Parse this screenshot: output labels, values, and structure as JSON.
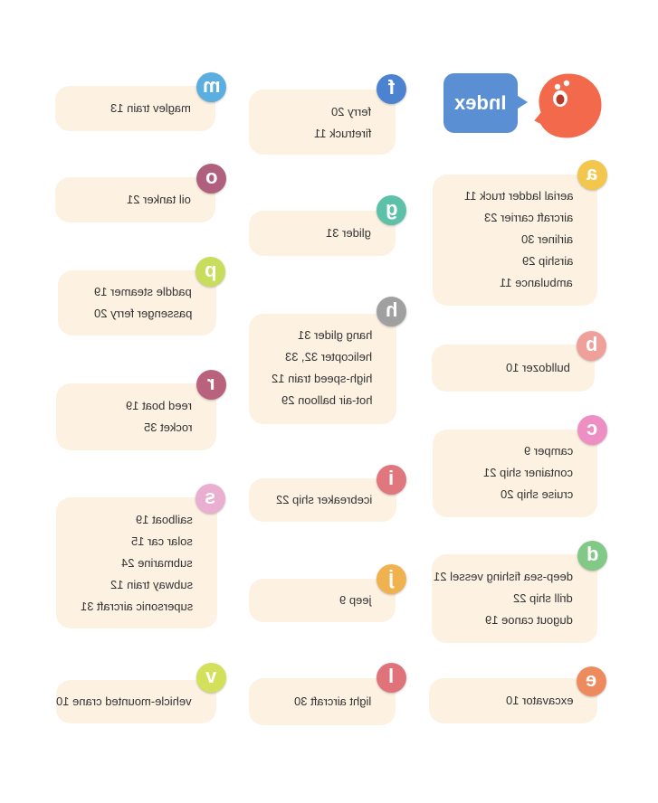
{
  "header": {
    "title": "Index"
  },
  "sections": [
    {
      "letter": "m",
      "color": "#5aaee0",
      "entries": [
        "maglev train 13"
      ]
    },
    {
      "letter": "f",
      "color": "#4c83d0",
      "entries": [
        "ferry 20",
        "firetruck 11"
      ]
    },
    {
      "letter": "a",
      "color": "#f3c64e",
      "entries": [
        "aerial ladder truck 11",
        "aircraft carrier 23",
        "airliner 30",
        "airship 29",
        "ambulance 11"
      ]
    },
    {
      "letter": "o",
      "color": "#b0607c",
      "entries": [
        "oil tanker 21"
      ]
    },
    {
      "letter": "g",
      "color": "#5cc1a8",
      "entries": [
        "glider 31"
      ]
    },
    {
      "letter": "p",
      "color": "#c8dd5c",
      "entries": [
        "paddle steamer 19",
        "passenger ferry 20"
      ]
    },
    {
      "letter": "h",
      "color": "#a0a0a0",
      "entries": [
        "hang glider 31",
        "helicopter 32, 33",
        "high-speed train 12",
        "hot-air balloon 29"
      ]
    },
    {
      "letter": "b",
      "color": "#f0a09a",
      "entries": [
        "bulldozer 10"
      ]
    },
    {
      "letter": "r",
      "color": "#b9627e",
      "entries": [
        "reed boat 19",
        "rocket 35"
      ]
    },
    {
      "letter": "c",
      "color": "#ee8fc4",
      "entries": [
        "camper 9",
        "container ship 21",
        "cruise ship 20"
      ]
    },
    {
      "letter": "i",
      "color": "#e0767e",
      "entries": [
        "icebreaker ship 22"
      ]
    },
    {
      "letter": "s",
      "color": "#e9aed0",
      "entries": [
        "sailboat 19",
        "solar car 15",
        "submarine 24",
        "subway train 12",
        "supersonic aircraft 31"
      ]
    },
    {
      "letter": "d",
      "color": "#82c886",
      "entries": [
        "deep-sea fishing vessel 21",
        "drill ship 22",
        "dugout canoe 19"
      ]
    },
    {
      "letter": "j",
      "color": "#f0b24e",
      "entries": [
        "jeep 9"
      ]
    },
    {
      "letter": "v",
      "color": "#d2e05a",
      "entries": [
        "vehicle-mounted crane 10"
      ]
    },
    {
      "letter": "l",
      "color": "#e0727a",
      "entries": [
        "light aircraft 30"
      ]
    },
    {
      "letter": "e",
      "color": "#ee8b5e",
      "entries": [
        "excavator 10"
      ]
    }
  ],
  "colors": {
    "card_bg": "#fdf1e2",
    "header_bubble": "#5a8fd3",
    "mascot": "#f26a4b"
  },
  "icons": {
    "mascot": "blob-mascot-icon"
  }
}
